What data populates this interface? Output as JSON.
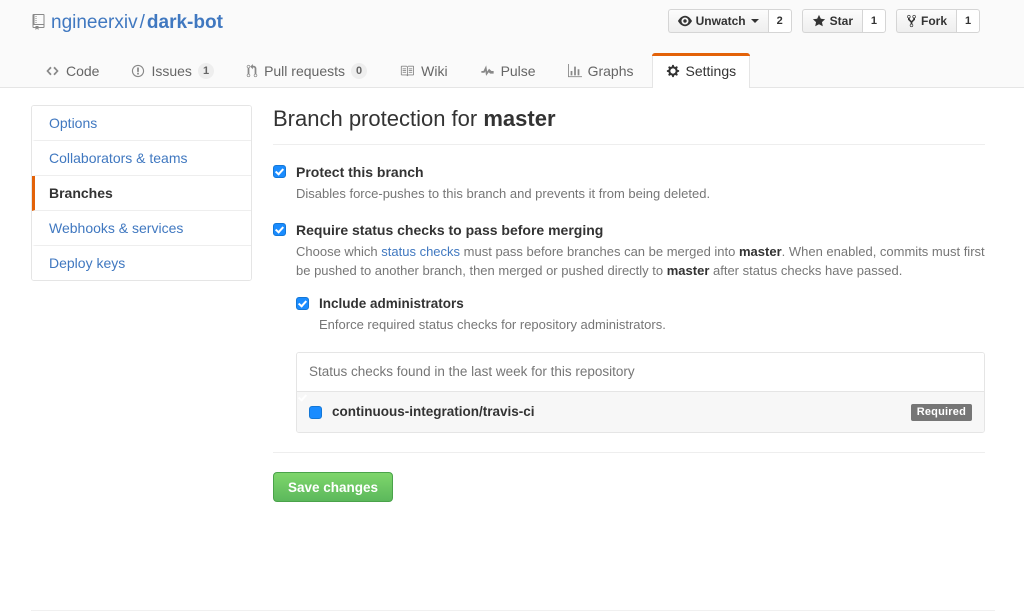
{
  "header": {
    "repo_icon": "repo-book-icon",
    "owner": "ngineerxiv",
    "separator": "/",
    "repo": "dark-bot",
    "actions": [
      {
        "icon": "eye-icon",
        "label": "Unwatch",
        "count": "2",
        "has_caret": true
      },
      {
        "icon": "star-icon",
        "label": "Star",
        "count": "1",
        "has_caret": false
      },
      {
        "icon": "fork-icon",
        "label": "Fork",
        "count": "1",
        "has_caret": false
      }
    ],
    "tabs": [
      {
        "icon": "code-icon",
        "label": "Code",
        "count": null,
        "selected": false
      },
      {
        "icon": "issue-opened-icon",
        "label": "Issues",
        "count": "1",
        "selected": false
      },
      {
        "icon": "git-pull-request-icon",
        "label": "Pull requests",
        "count": "0",
        "selected": false
      },
      {
        "icon": "book-icon",
        "label": "Wiki",
        "count": null,
        "selected": false
      },
      {
        "icon": "pulse-icon",
        "label": "Pulse",
        "count": null,
        "selected": false
      },
      {
        "icon": "graph-icon",
        "label": "Graphs",
        "count": null,
        "selected": false
      },
      {
        "icon": "gear-icon",
        "label": "Settings",
        "count": null,
        "selected": true
      }
    ]
  },
  "sidebar": {
    "items": [
      {
        "label": "Options",
        "selected": false
      },
      {
        "label": "Collaborators & teams",
        "selected": false
      },
      {
        "label": "Branches",
        "selected": true
      },
      {
        "label": "Webhooks & services",
        "selected": false
      },
      {
        "label": "Deploy keys",
        "selected": false
      }
    ]
  },
  "main": {
    "heading_prefix": "Branch protection for ",
    "heading_branch": "master",
    "protect_branch": {
      "title": "Protect this branch",
      "description": "Disables force-pushes to this branch and prevents it from being deleted.",
      "checked": true
    },
    "require_status_checks": {
      "title": "Require status checks to pass before merging",
      "desc_part1": "Choose which ",
      "desc_link": "status checks",
      "desc_part2": " must pass before branches can be merged into ",
      "desc_branch1": "master",
      "desc_part3": ". When enabled, commits must first be pushed to another branch, then merged or pushed directly to ",
      "desc_branch2": "master",
      "desc_part4": " after status checks have passed.",
      "checked": true
    },
    "include_administrators": {
      "title": "Include administrators",
      "description": "Enforce required status checks for repository administrators.",
      "checked": true
    },
    "status_checks_box": {
      "header": "Status checks found in the last week for this repository",
      "rows": [
        {
          "name": "continuous-integration/travis-ci",
          "checked": true,
          "badge": "Required"
        }
      ]
    },
    "save_button": "Save changes"
  },
  "colors": {
    "link": "#4078c0",
    "accent_orange": "#e36209",
    "checkbox_blue": "#1a8cff",
    "save_green": "#5cb85c",
    "badge_gray": "#767676"
  }
}
